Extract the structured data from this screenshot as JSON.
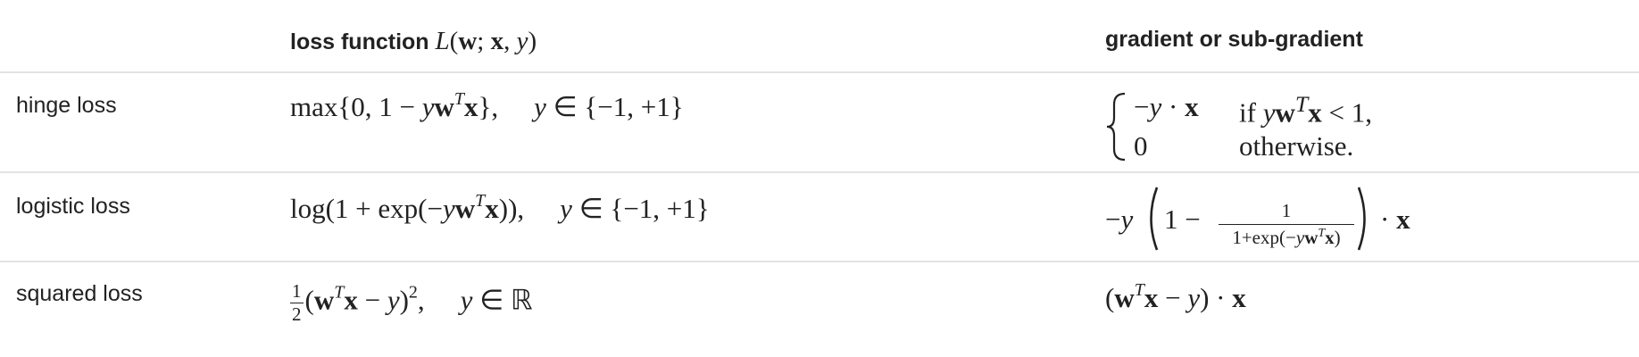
{
  "headers": {
    "loss_prefix": "loss function ",
    "loss_math": "L(w; x, y)",
    "gradient": "gradient or sub-gradient"
  },
  "rows": [
    {
      "label": "hinge loss",
      "loss": "max{0, 1 − yw^T x},   y ∈ {−1, +1}",
      "gradient_case1": "−y · x",
      "gradient_cond1": "if yw^T x < 1,",
      "gradient_case2": "0",
      "gradient_cond2": "otherwise."
    },
    {
      "label": "logistic loss",
      "loss": "log(1 + exp(−yw^T x)),   y ∈ {−1, +1}",
      "gradient": "−y (1 − 1 / (1+exp(−yw^T x))) · x"
    },
    {
      "label": "squared loss",
      "loss": "1/2 (w^T x − y)^2,   y ∈ ℝ",
      "gradient": "(w^T x − y) · x"
    }
  ]
}
